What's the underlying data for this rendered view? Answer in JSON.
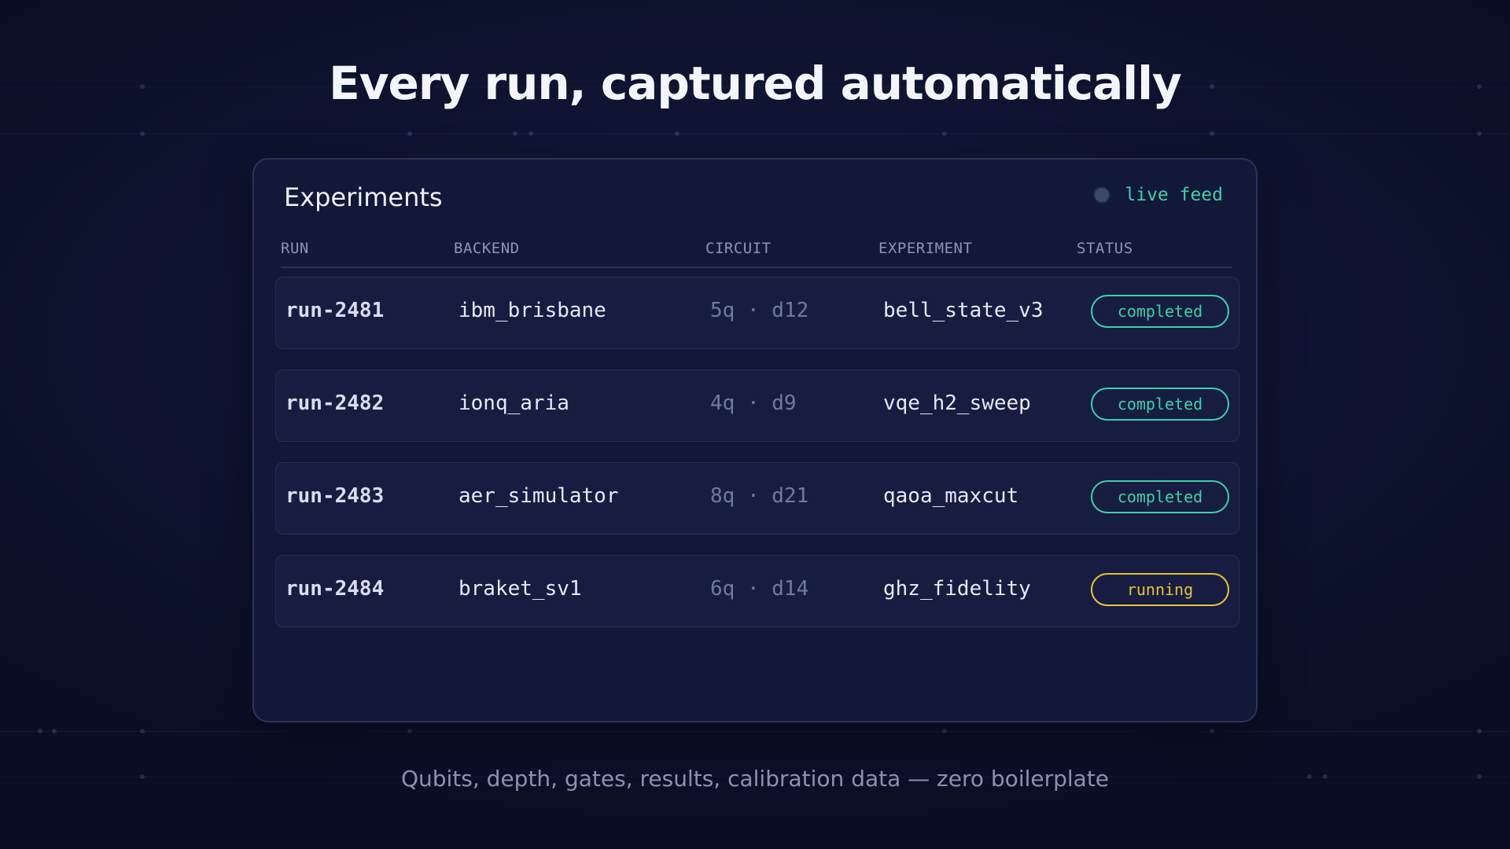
{
  "headline": "Every run, captured automatically",
  "panel": {
    "title": "Experiments",
    "live_label": "live feed"
  },
  "table": {
    "columns": [
      "RUN",
      "BACKEND",
      "CIRCUIT",
      "EXPERIMENT",
      "STATUS"
    ],
    "rows": [
      {
        "run": "run-2481",
        "backend": "ibm_brisbane",
        "circuit": "5q · d12",
        "experiment": "bell_state_v3",
        "status": "completed"
      },
      {
        "run": "run-2482",
        "backend": "ionq_aria",
        "circuit": "4q · d9",
        "experiment": "vqe_h2_sweep",
        "status": "completed"
      },
      {
        "run": "run-2483",
        "backend": "aer_simulator",
        "circuit": "8q · d21",
        "experiment": "qaoa_maxcut",
        "status": "completed"
      },
      {
        "run": "run-2484",
        "backend": "braket_sv1",
        "circuit": "6q · d14",
        "experiment": "ghz_fidelity",
        "status": "running"
      }
    ]
  },
  "subtitle": "Qubits, depth, gates, results, calibration data — zero boilerplate",
  "colors": {
    "background": "#0e1330",
    "panel": "#121838",
    "completed": "#3fcfa8",
    "running": "#e8c33f",
    "live_dot": "#3b4a63"
  },
  "icons": {
    "live_indicator": "status-dot-icon"
  }
}
